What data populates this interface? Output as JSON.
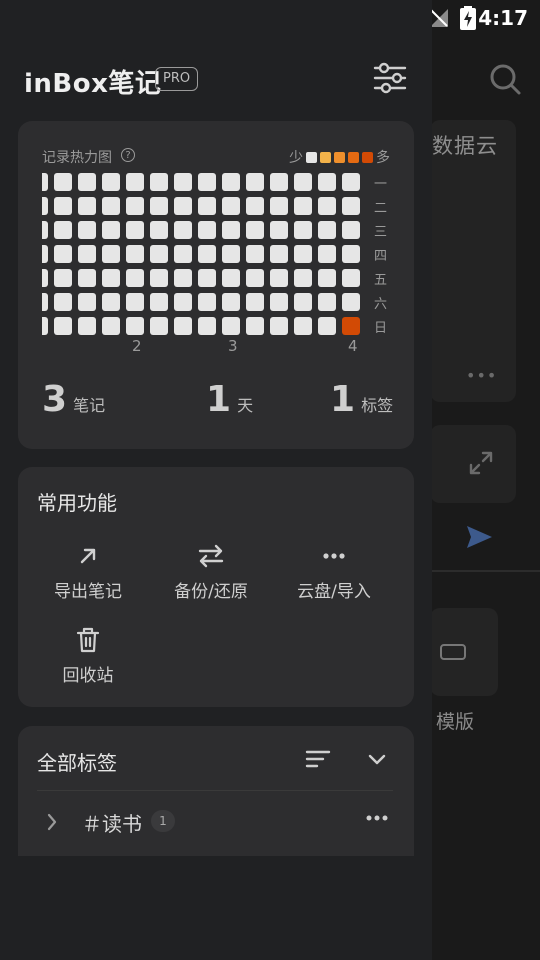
{
  "status_bar": {
    "time": "4:17"
  },
  "background_app": {
    "card_text": "数据云",
    "template_label": "模版",
    "more_dots": "•••"
  },
  "drawer": {
    "app_title": "inBox笔记",
    "pro_badge": "PRO",
    "heatmap": {
      "title": "记录热力图",
      "help": "?",
      "legend_less": "少",
      "legend_more": "多",
      "legend_colors": [
        "#e6e6e6",
        "#f2b24a",
        "#ee8f2c",
        "#e46a12",
        "#d24a05"
      ],
      "day_labels": [
        "一",
        "二",
        "三",
        "四",
        "五",
        "六",
        "日"
      ],
      "month_labels": [
        "2",
        "3",
        "4"
      ],
      "empty_color": "#e6e6e6",
      "active_color": "#d24a05",
      "columns": 14,
      "rows": 7,
      "active_cells": [
        {
          "col": 13,
          "row": 6,
          "level": 4
        }
      ]
    },
    "stats": [
      {
        "value": "3",
        "unit": "笔记"
      },
      {
        "value": "1",
        "unit": "天"
      },
      {
        "value": "1",
        "unit": "标签"
      }
    ],
    "functions": {
      "title": "常用功能",
      "items": [
        {
          "label": "导出笔记",
          "icon": "arrow-up-right-icon"
        },
        {
          "label": "备份/还原",
          "icon": "swap-arrows-icon"
        },
        {
          "label": "云盘/导入",
          "icon": "more-dots-icon"
        },
        {
          "label": "回收站",
          "icon": "trash-icon"
        }
      ]
    },
    "tags": {
      "title": "全部标签",
      "items": [
        {
          "name": "＃读书",
          "count": "1"
        }
      ],
      "more": "•••"
    }
  }
}
